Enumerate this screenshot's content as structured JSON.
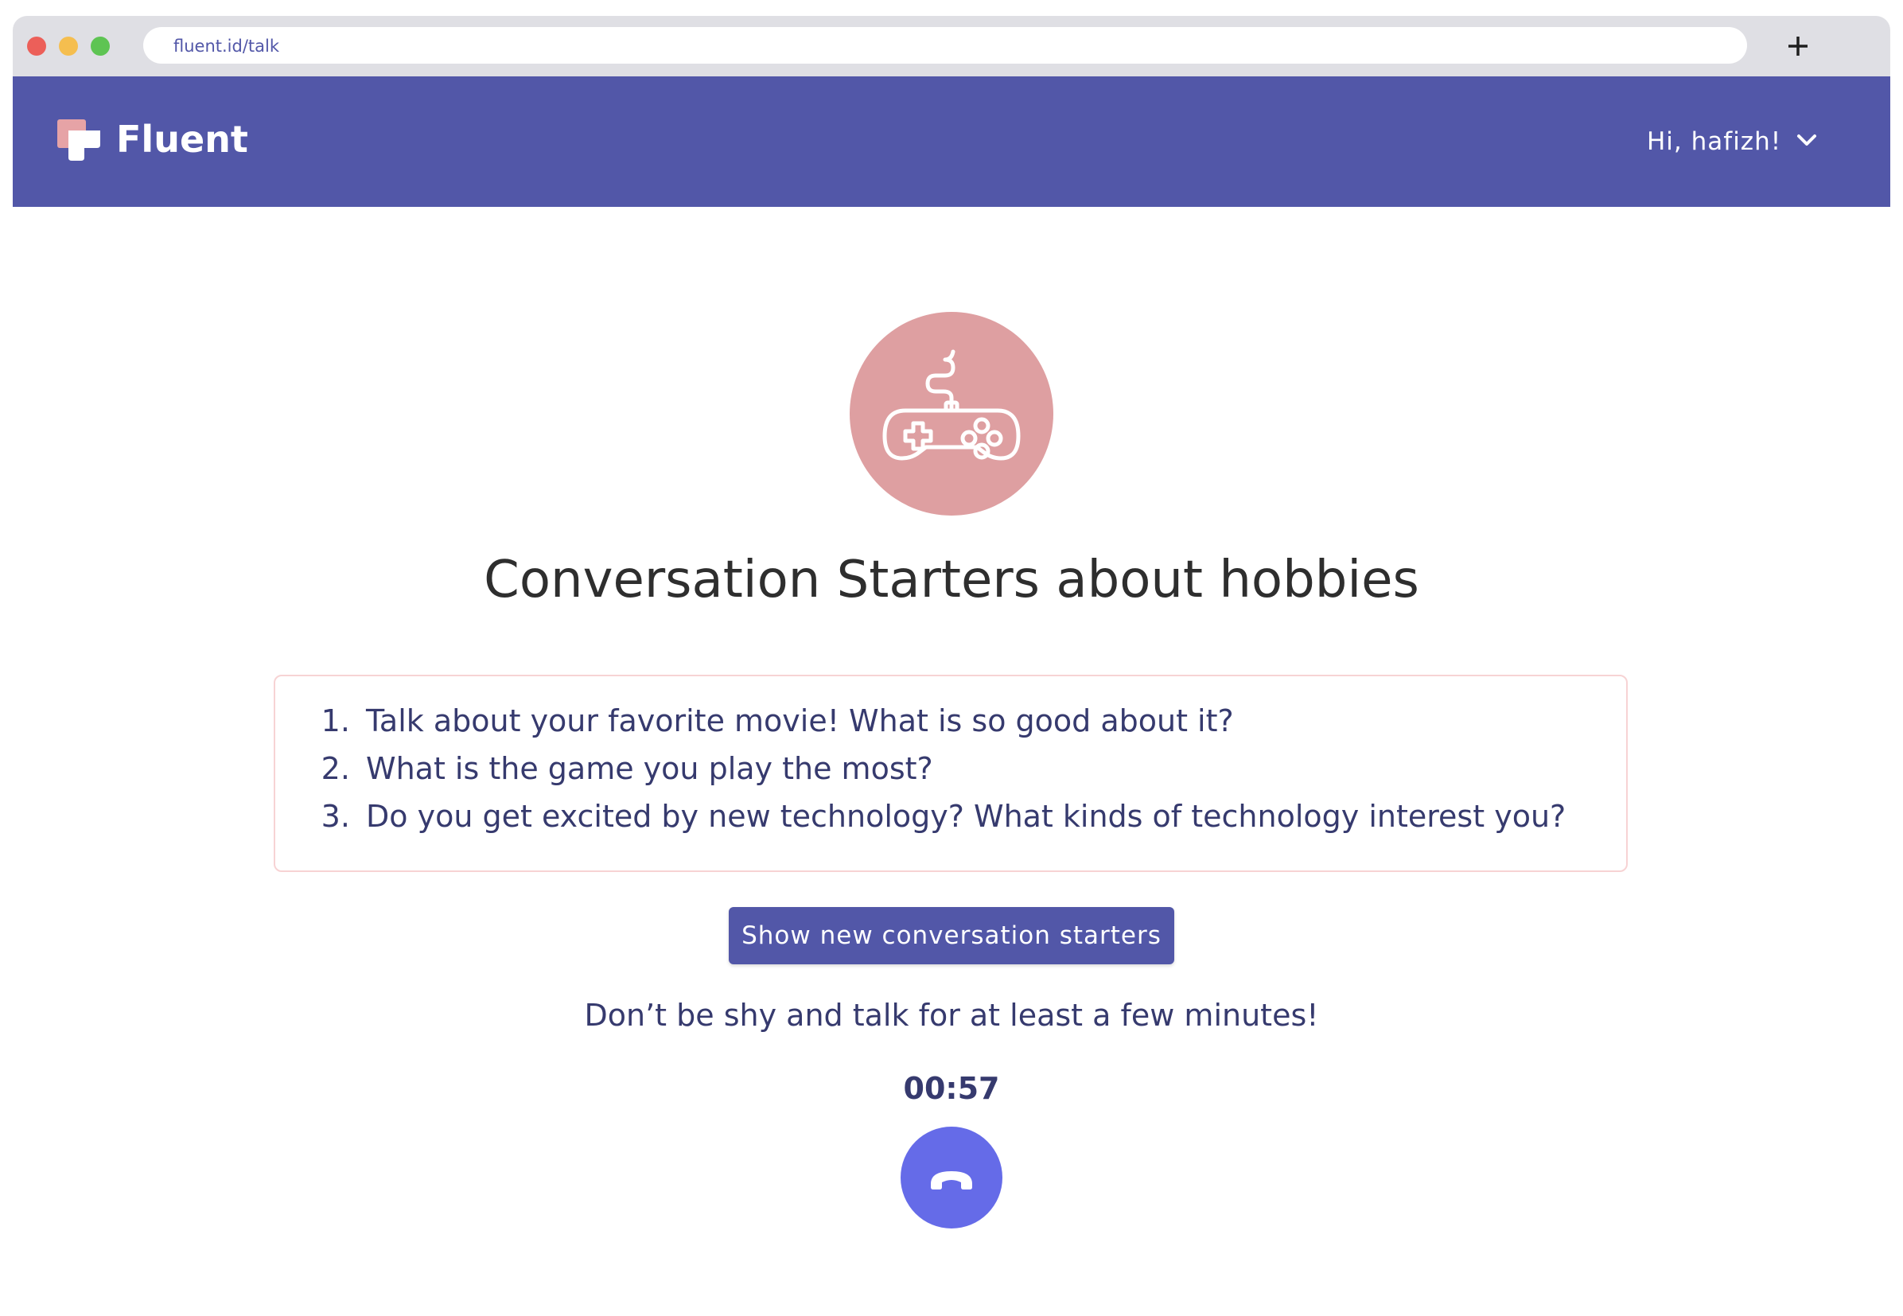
{
  "browser": {
    "url": "fluent.id/talk",
    "new_tab_icon": "plus-icon"
  },
  "header": {
    "brand": "Fluent",
    "greeting": "Hi, hafizh!",
    "menu_icon": "chevron-down-icon",
    "background_color": "#5257a8"
  },
  "main": {
    "topic_icon": "gamepad-icon",
    "topic_icon_bg": "#de9fa1",
    "title": "Conversation Starters about hobbies",
    "starters": [
      "Talk about your favorite movie! What is so good about it?",
      "What is the game you play the most?",
      "Do you get excited by new technology? What kinds of technology interest you?"
    ],
    "new_starters_button": "Show new conversation starters",
    "encouragement": "Don’t be shy and talk for at least a few minutes!",
    "timer": "00:57",
    "hangup_icon": "phone-hangup-icon",
    "hangup_color": "#656be8"
  }
}
